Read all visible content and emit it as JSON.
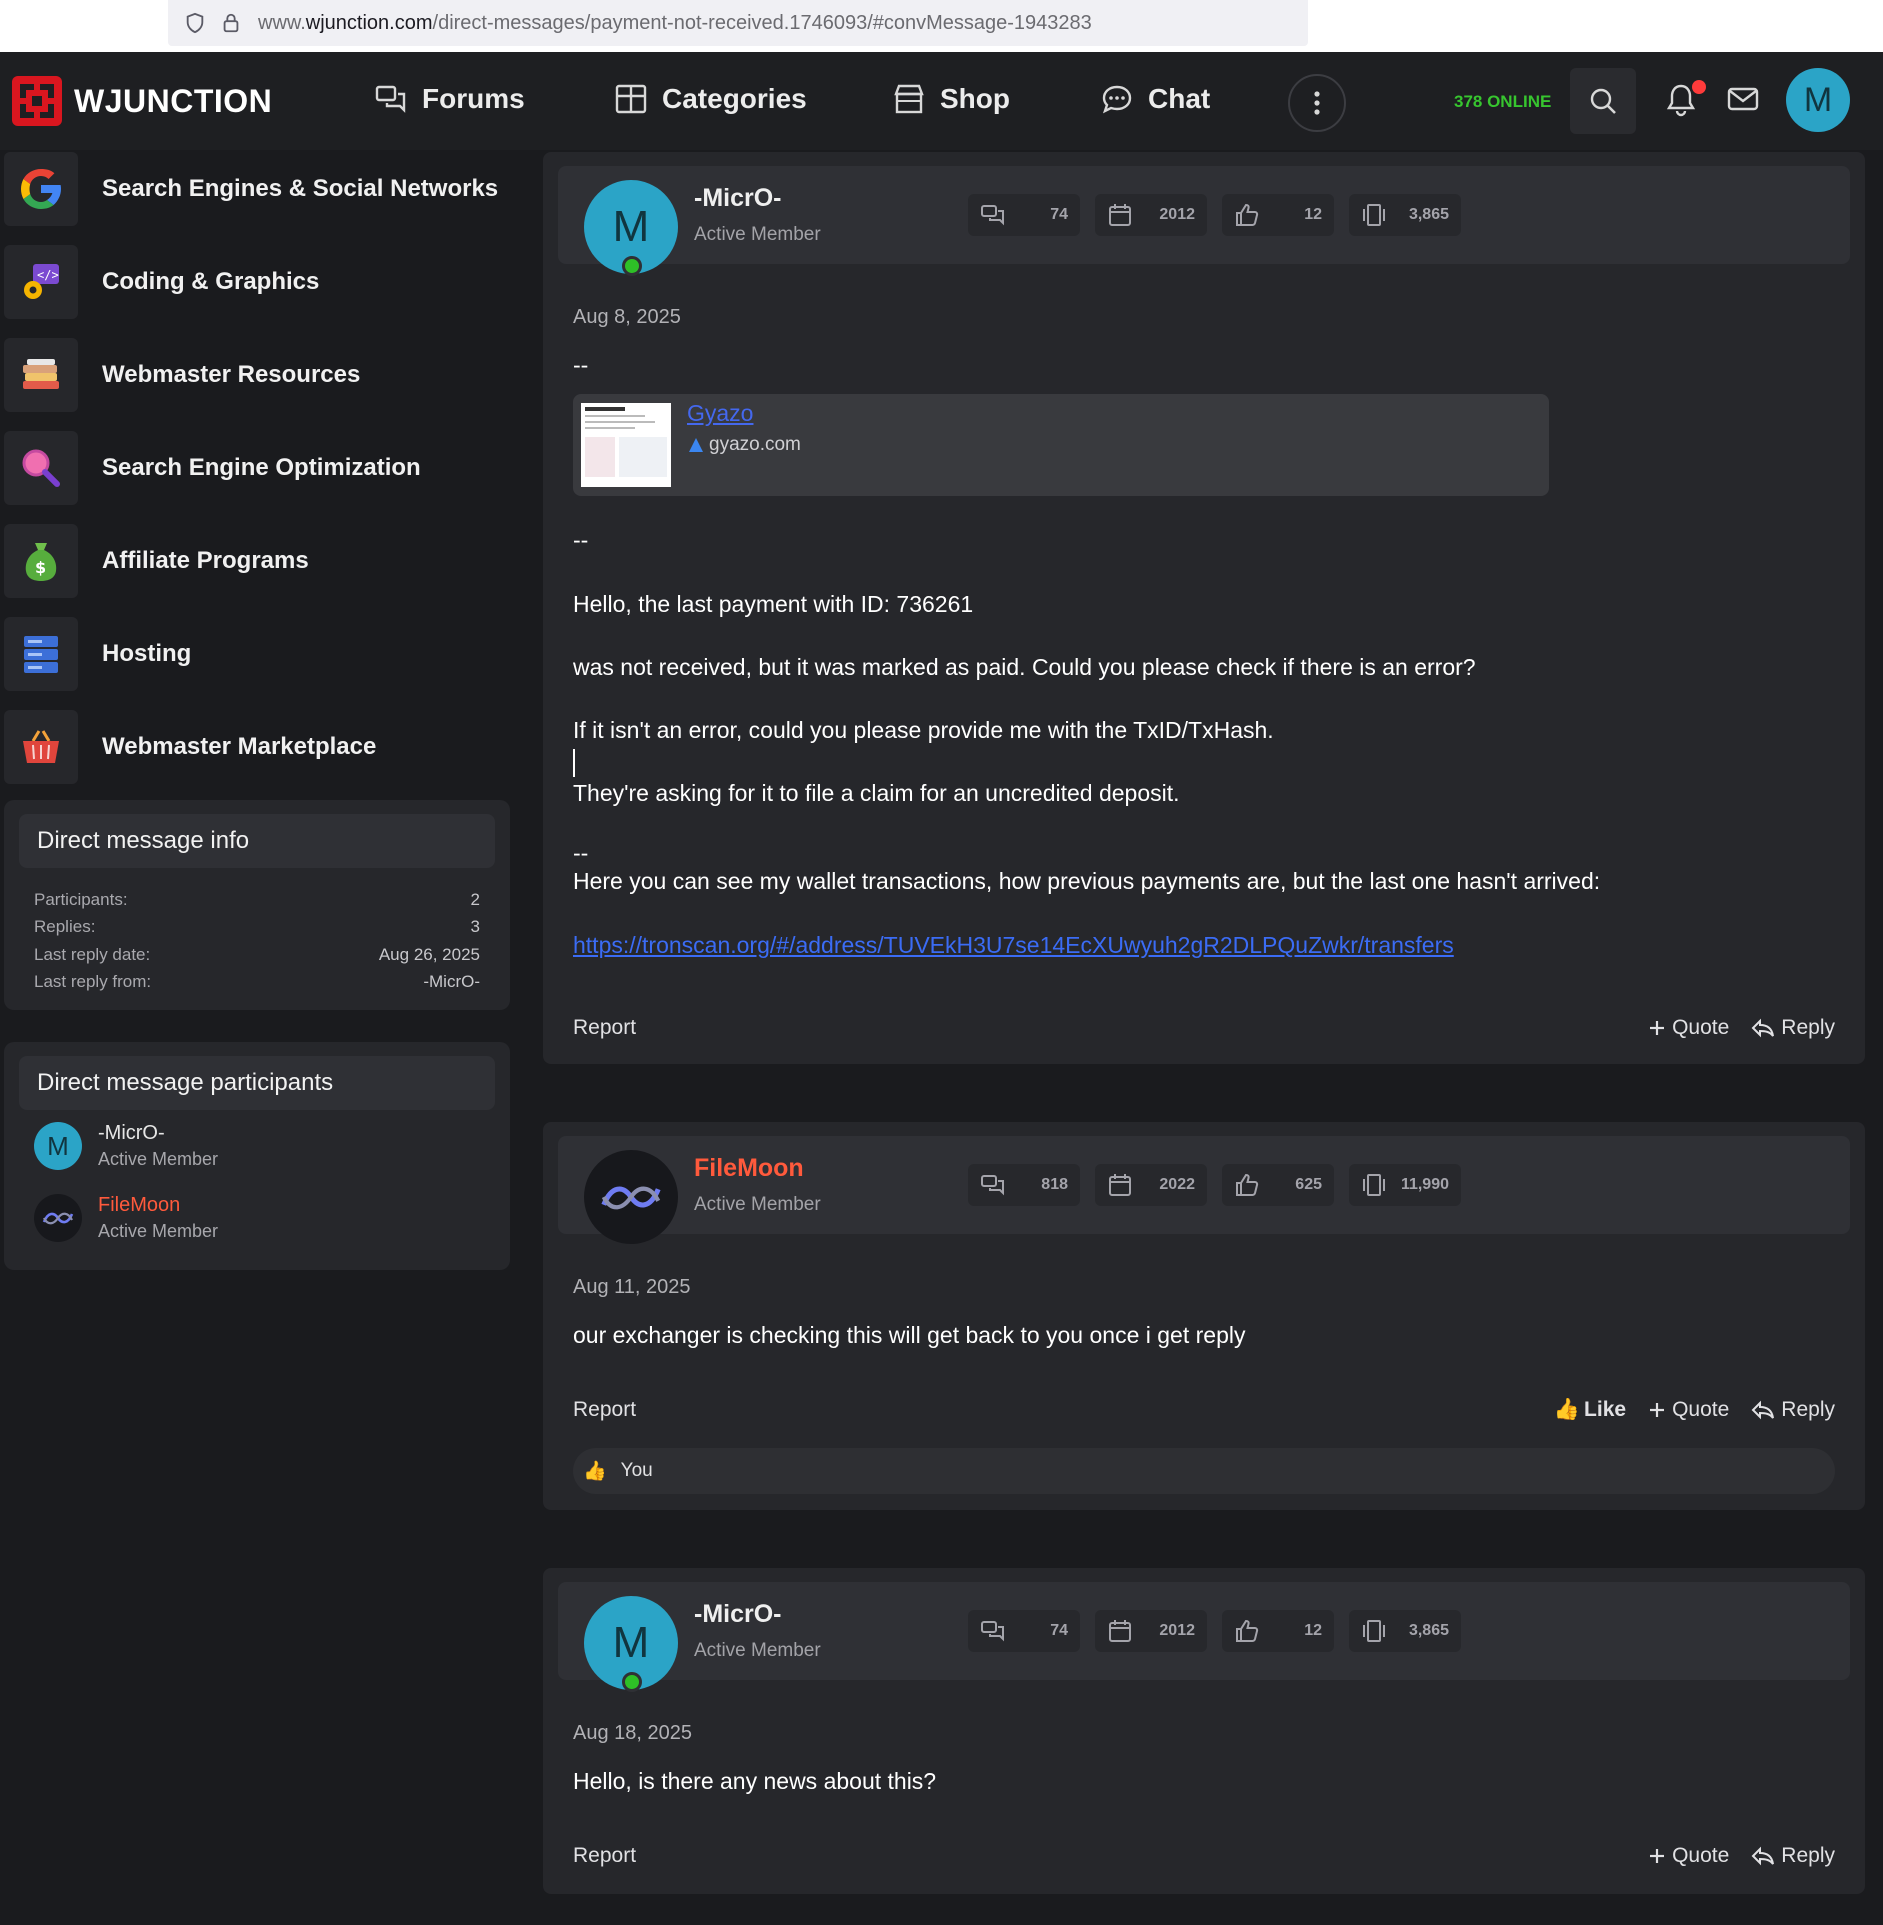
{
  "browser": {
    "url_prefix": "www.",
    "url_domain": "wjunction.com",
    "url_path": "/direct-messages/payment-not-received.1746093/#convMessage-1943283"
  },
  "header": {
    "logo_text": "WJUNCTION",
    "nav": [
      {
        "label": "Forums",
        "icon": "forums-icon"
      },
      {
        "label": "Categories",
        "icon": "categories-icon"
      },
      {
        "label": "Shop",
        "icon": "shop-icon"
      },
      {
        "label": "Chat",
        "icon": "chat-icon"
      }
    ],
    "online_count": "378 ONLINE",
    "user_initial": "M"
  },
  "sidebar": {
    "categories": [
      {
        "label": "Search Engines & Social Networks",
        "icon": "google-icon"
      },
      {
        "label": "Coding & Graphics",
        "icon": "coding-icon"
      },
      {
        "label": "Webmaster Resources",
        "icon": "books-icon"
      },
      {
        "label": "Search Engine Optimization",
        "icon": "magnifier-icon"
      },
      {
        "label": "Affiliate Programs",
        "icon": "money-bag-icon"
      },
      {
        "label": "Hosting",
        "icon": "server-icon"
      },
      {
        "label": "Webmaster Marketplace",
        "icon": "basket-icon"
      }
    ],
    "info": {
      "title": "Direct message info",
      "rows": [
        {
          "key": "Participants:",
          "value": "2"
        },
        {
          "key": "Replies:",
          "value": "3"
        },
        {
          "key": "Last reply date:",
          "value": "Aug 26, 2025"
        },
        {
          "key": "Last reply from:",
          "value": "-MicrO-"
        }
      ]
    },
    "participants": {
      "title": "Direct message participants",
      "list": [
        {
          "name": "-MicrO-",
          "role": "Active Member",
          "initial": "M",
          "name_color": "#e6e6e6"
        },
        {
          "name": "FileMoon",
          "role": "Active Member",
          "initial": "",
          "name_color": "#ff5a3c"
        }
      ]
    }
  },
  "posts": [
    {
      "author": "-MicrO-",
      "role": "Active Member",
      "initial": "M",
      "stats": {
        "messages": "74",
        "joined": "2012",
        "reactions": "12",
        "points": "3,865"
      },
      "date": "Aug 8, 2025",
      "lines": {
        "sep1": "--",
        "sep2": "--",
        "p1": "Hello, the last payment with ID: 736261",
        "p2": "was not received, but it was marked as paid. Could you please check if there is an error?",
        "p3": "If it isn't an error, could you please provide me with the TxID/TxHash.",
        "p4": "They're asking for it to file a claim for an uncredited deposit.",
        "sep3": "--",
        "p5": "Here you can see my wallet transactions, how previous payments are, but the last one hasn't arrived:",
        "link": "https://tronscan.org/#/address/TUVEkH3U7se14EcXUwyuh2gR2DLPQuZwkr/transfers"
      },
      "embed": {
        "title": "Gyazo",
        "domain": "gyazo.com"
      },
      "actions": {
        "report": "Report",
        "quote": "Quote",
        "reply": "Reply"
      }
    },
    {
      "author": "FileMoon",
      "role": "Active Member",
      "stats": {
        "messages": "818",
        "joined": "2022",
        "reactions": "625",
        "points": "11,990"
      },
      "date": "Aug 11, 2025",
      "body": "our exchanger is checking this will get back to you once i get reply",
      "actions": {
        "report": "Report",
        "like": "Like",
        "quote": "Quote",
        "reply": "Reply"
      },
      "reaction_by": "You"
    },
    {
      "author": "-MicrO-",
      "role": "Active Member",
      "initial": "M",
      "stats": {
        "messages": "74",
        "joined": "2012",
        "reactions": "12",
        "points": "3,865"
      },
      "date": "Aug 18, 2025",
      "body": "Hello, is there any news about this?",
      "actions": {
        "report": "Report",
        "quote": "Quote",
        "reply": "Reply"
      }
    }
  ],
  "colors": {
    "accent_avatar": "#2ba4c7",
    "filemoon_name": "#ff5a3c",
    "online_green": "#37c52f",
    "link_blue": "#3b6cf5"
  }
}
